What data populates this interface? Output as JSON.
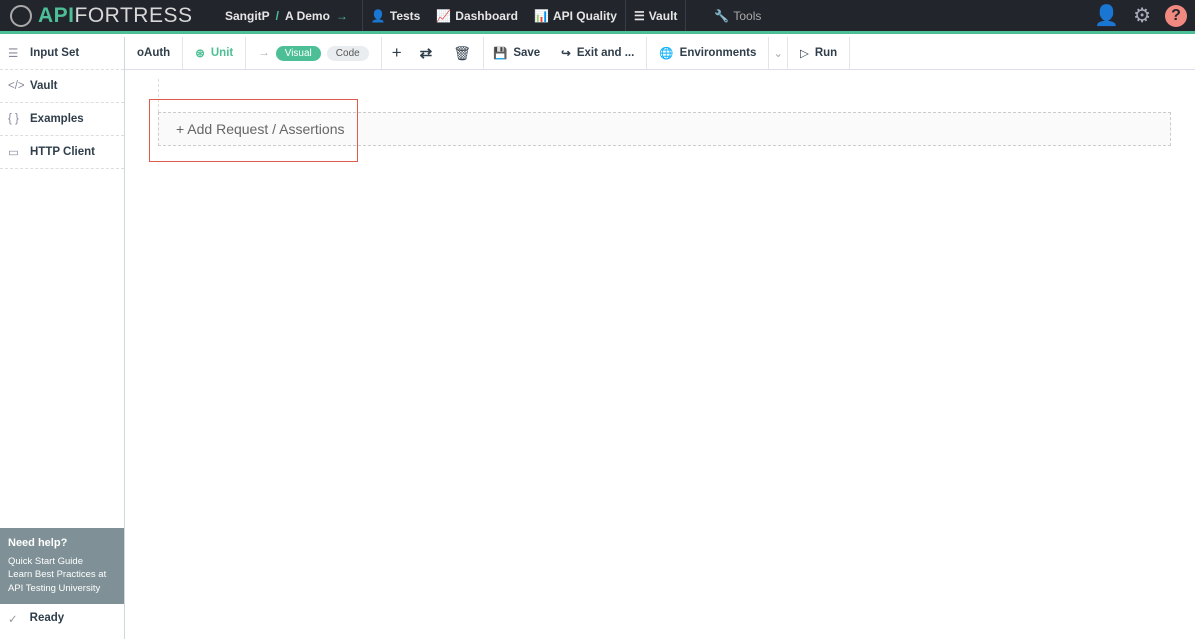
{
  "header": {
    "logo_api": "API",
    "logo_rest": "FORTRESS",
    "user": "SangitP",
    "sep": "/",
    "project": "A Demo",
    "nav": [
      "Tests",
      "Dashboard",
      "API Quality",
      "Vault",
      "Tools"
    ]
  },
  "sidebar": {
    "items": [
      {
        "label": "Input Set",
        "icon": "list-icon"
      },
      {
        "label": "Vault",
        "icon": "code-icon"
      },
      {
        "label": "Examples",
        "icon": "braces-icon"
      },
      {
        "label": "HTTP Client",
        "icon": "window-icon"
      }
    ],
    "help": {
      "title": "Need help?",
      "lines": [
        "Quick Start Guide",
        "Learn Best Practices at",
        "API Testing University"
      ]
    },
    "status": "Ready"
  },
  "toolbar": {
    "test_name": "oAuth",
    "unit": "Unit",
    "visual": "Visual",
    "code": "Code",
    "save": "Save",
    "exit": "Exit and ...",
    "environments": "Environments",
    "run": "Run"
  },
  "main": {
    "add_label": "+ Add Request / Assertions"
  },
  "colors": {
    "accent": "#4dbf96",
    "header_bg": "#23252d",
    "highlight": "#e05a4e"
  }
}
